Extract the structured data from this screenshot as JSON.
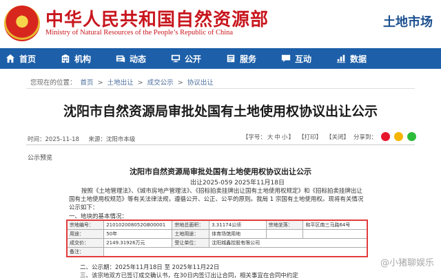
{
  "site": {
    "title": "中华人民共和国自然资源部",
    "subtitle": "Ministry of Natural Resources of the People’s Republic of China",
    "section": "土地市场"
  },
  "nav": [
    {
      "label": "首页",
      "icon": "home-icon"
    },
    {
      "label": "机构",
      "icon": "building-icon"
    },
    {
      "label": "动态",
      "icon": "news-icon"
    },
    {
      "label": "公开",
      "icon": "monitor-icon"
    },
    {
      "label": "服务",
      "icon": "service-icon"
    },
    {
      "label": "互动",
      "icon": "chat-icon"
    },
    {
      "label": "数据",
      "icon": "chart-icon"
    }
  ],
  "breadcrumb": {
    "prefix": "您现在的位置：",
    "items": [
      "首页",
      "土地出让",
      "成交公示",
      "协议出让"
    ],
    "separator": ">"
  },
  "article": {
    "title": "沈阳市自然资源局审批处国有土地使用权协议出让公示",
    "date_label": "时间：2025-11-18",
    "source_label": "来源：沈阳市本级",
    "font_label": "【字号：",
    "font_sizes": [
      "大",
      "中",
      "小"
    ],
    "font_end": "】",
    "print": "【打印】",
    "close": "【关闭】",
    "share": "分享到："
  },
  "preview_label": "公示预览",
  "doc": {
    "title": "沈阳市自然资源局审批处国有土地使用权协议出让公示",
    "number": "出让2025-059        2025年11月18日",
    "paragraph": "按照《土地管理法》、《城市房地产管理法》、《招标拍卖挂牌出让国有土地使用权规定》和《招标拍卖挂牌出让国有土地使用权规范》等有关法律法规，遵循公开、公正、公平的原则。我局 1 宗国有土地使用权。现将有关情况公示如下：",
    "section1": "一、地块的基本情况：",
    "section2": "二、公示期：2025年11月18日 至 2025年11月22日",
    "section3": "三、该宗地双方已签订成交确认书，在30日内签订出让合同，相关事宜在合同中约定"
  },
  "table": {
    "row1": [
      "宗地编号：",
      "210102008052GB00001",
      "宗地总面积：",
      "3.31174公顷",
      "宗地坐落：",
      "和平区南三马路64号"
    ],
    "row2": [
      "用途：",
      "50年",
      "土地用途：",
      "体育场馆用地"
    ],
    "row3": [
      "成交价：",
      "2149.31926万元",
      "受让单位：",
      "沈阳城鑫控股有限公司"
    ],
    "row4": [
      "备注："
    ]
  },
  "watermark": "@小猪聊娱乐",
  "colors": {
    "brand_red": "#c8161e",
    "nav_blue": "#1d5fa8",
    "table_border": "#e23b3b"
  }
}
